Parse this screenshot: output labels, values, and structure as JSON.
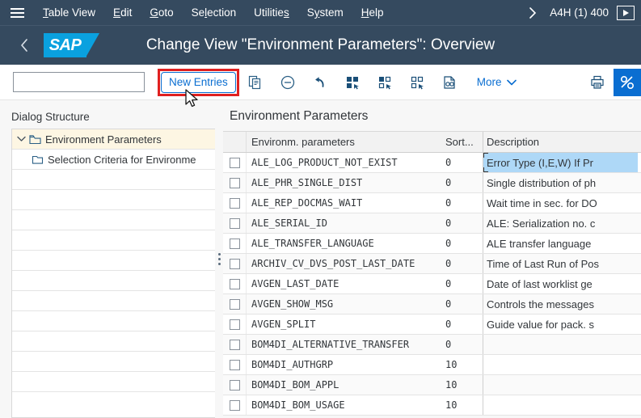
{
  "menubar": {
    "burger_icon": "hamburger-menu-icon",
    "items": [
      {
        "label": "Table View",
        "accel": "T"
      },
      {
        "label": "Edit",
        "accel": "E"
      },
      {
        "label": "Goto",
        "accel": "G"
      },
      {
        "label": "Selection",
        "accel": "S"
      },
      {
        "label": "Utilities",
        "accel": "s"
      },
      {
        "label": "System",
        "accel": "y"
      },
      {
        "label": "Help",
        "accel": "H"
      }
    ],
    "overflow_icon": "chevron-right-icon",
    "system_id": "A4H (1) 400",
    "play_icon": "play-box-icon"
  },
  "shellbar": {
    "back_icon": "back-chevron-icon",
    "logo_text": "SAP",
    "title": "Change View \"Environment Parameters\": Overview"
  },
  "toolbar": {
    "combo_value": "",
    "combo_placeholder": "",
    "combo_icon": "chevron-down-icon",
    "new_entries_label": "New Entries",
    "copy_icon": "copy-icon",
    "delete_icon": "minus-circle-icon",
    "undo_icon": "undo-icon",
    "select_all_icon": "select-all-icon",
    "select_block_icon": "select-block-icon",
    "deselect_all_icon": "deselect-all-icon",
    "variant_icon": "document-search-icon",
    "more_label": "More",
    "more_icon": "chevron-down-icon",
    "print_icon": "print-icon",
    "highlight_color": "#e02020",
    "accent_color": "#0a6ed1"
  },
  "sidebar": {
    "title": "Dialog Structure",
    "nodes": [
      {
        "label": "Environment Parameters",
        "level": 0,
        "expanded": true,
        "selected": true,
        "icon": "folder-open-icon",
        "toggle_icon": "chevron-down-icon"
      },
      {
        "label": "Selection Criteria for Environme",
        "level": 1,
        "expanded": false,
        "selected": false,
        "icon": "folder-icon",
        "toggle_icon": ""
      }
    ],
    "empty_row_count": 11,
    "splitter_icon": "drag-handle-dots-icon"
  },
  "main": {
    "title": "Environment Parameters",
    "table": {
      "columns": [
        "",
        "Environm. parameters",
        "Sort...",
        "Description"
      ],
      "selected_cell": {
        "row": 0,
        "column": "Description"
      },
      "rows": [
        {
          "checked": false,
          "param": "ALE_LOG_PRODUCT_NOT_EXIST",
          "sort": "0",
          "desc": "Error Type (I,E,W) If Pr"
        },
        {
          "checked": false,
          "param": "ALE_PHR_SINGLE_DIST",
          "sort": "0",
          "desc": "Single distribution of ph"
        },
        {
          "checked": false,
          "param": "ALE_REP_DOCMAS_WAIT",
          "sort": "0",
          "desc": "Wait time in sec. for DO"
        },
        {
          "checked": false,
          "param": "ALE_SERIAL_ID",
          "sort": "0",
          "desc": "ALE: Serialization no. c"
        },
        {
          "checked": false,
          "param": "ALE_TRANSFER_LANGUAGE",
          "sort": "0",
          "desc": "ALE transfer language"
        },
        {
          "checked": false,
          "param": "ARCHIV_CV_DVS_POST_LAST_DATE",
          "sort": "0",
          "desc": "Time of Last Run of Pos"
        },
        {
          "checked": false,
          "param": "AVGEN_LAST_DATE",
          "sort": "0",
          "desc": "Date of last worklist ge"
        },
        {
          "checked": false,
          "param": "AVGEN_SHOW_MSG",
          "sort": "0",
          "desc": "Controls the messages"
        },
        {
          "checked": false,
          "param": "AVGEN_SPLIT",
          "sort": "0",
          "desc": "Guide value for pack. s"
        },
        {
          "checked": false,
          "param": "BOM4DI_ALTERNATIVE_TRANSFER",
          "sort": "0",
          "desc": ""
        },
        {
          "checked": false,
          "param": "BOM4DI_AUTHGRP",
          "sort": "10",
          "desc": ""
        },
        {
          "checked": false,
          "param": "BOM4DI_BOM_APPL",
          "sort": "10",
          "desc": ""
        },
        {
          "checked": false,
          "param": "BOM4DI_BOM_USAGE",
          "sort": "10",
          "desc": ""
        }
      ]
    }
  },
  "cursor": {
    "icon": "mouse-pointer-icon"
  }
}
